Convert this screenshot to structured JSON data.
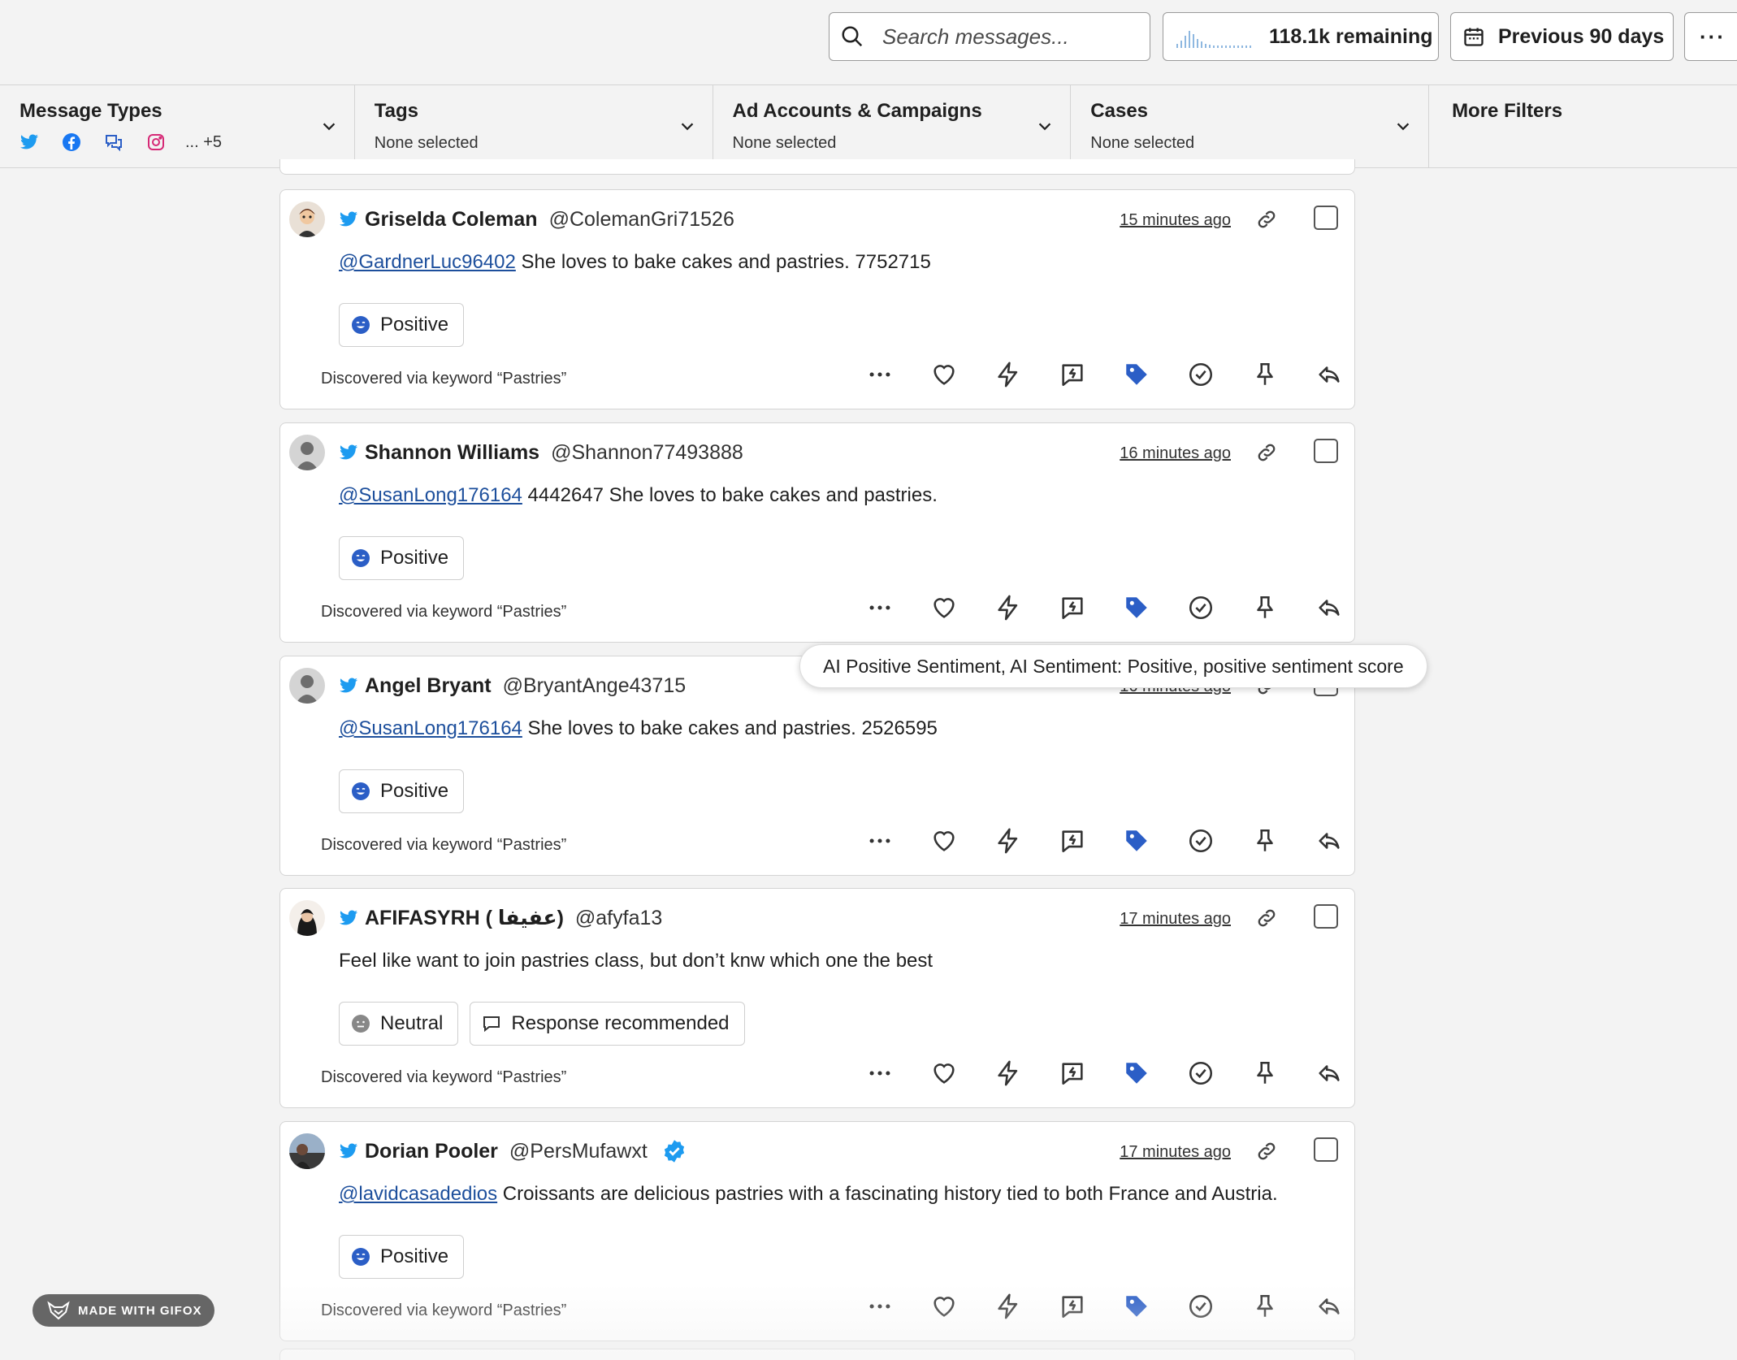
{
  "search": {
    "placeholder": "Search messages..."
  },
  "quota": {
    "label": "118.1k remaining"
  },
  "date_range": {
    "label": "Previous 90 days"
  },
  "more_menu": {
    "label": "···"
  },
  "filters": {
    "message_types": {
      "title": "Message Types",
      "extra": "... +5",
      "icons": [
        "twitter-icon",
        "facebook-icon",
        "chat-icon",
        "instagram-icon"
      ]
    },
    "tags": {
      "title": "Tags",
      "value": "None selected"
    },
    "ad_accounts": {
      "title": "Ad Accounts & Campaigns",
      "value": "None selected"
    },
    "cases": {
      "title": "Cases",
      "value": "None selected"
    },
    "more_filters": {
      "title": "More Filters"
    }
  },
  "messages": [
    {
      "name": "Griselda Coleman",
      "handle": "@ColemanGri71526",
      "time": "15 minutes ago",
      "mention": "@GardnerLuc96402",
      "text": " She loves to bake cakes and pastries. 7752715",
      "badges": [
        {
          "label": "Positive",
          "icon": "positive-icon"
        }
      ],
      "discovered": "Discovered via keyword “Pastries”",
      "avatar": "cartoon"
    },
    {
      "name": "Shannon Williams",
      "handle": "@Shannon77493888",
      "time": "16 minutes ago",
      "mention": "@SusanLong176164",
      "text": " 4442647 She loves to bake cakes and pastries.",
      "badges": [
        {
          "label": "Positive",
          "icon": "positive-icon"
        }
      ],
      "discovered": "Discovered via keyword “Pastries”",
      "avatar": "default"
    },
    {
      "name": "Angel Bryant",
      "handle": "@BryantAnge43715",
      "time": "16 minutes ago",
      "mention": "@SusanLong176164",
      "text": " She loves to bake cakes and pastries. 2526595",
      "badges": [
        {
          "label": "Positive",
          "icon": "positive-icon"
        }
      ],
      "discovered": "Discovered via keyword “Pastries”",
      "avatar": "default"
    },
    {
      "name": "AFIFASYRH ( عفيفا)",
      "handle": "@afyfa13",
      "time": "17 minutes ago",
      "mention": "",
      "text": "Feel like want to join pastries class, but don’t knw which one the best",
      "badges": [
        {
          "label": "Neutral",
          "icon": "neutral-icon"
        },
        {
          "label": "Response recommended",
          "icon": "comment-icon"
        }
      ],
      "discovered": "Discovered via keyword “Pastries”",
      "avatar": "photo-dark"
    },
    {
      "name": "Dorian Pooler",
      "handle": "@PersMufawxt",
      "time": "17 minutes ago",
      "mention": "@lavidcasadedios",
      "text": " Croissants are delicious pastries with a fascinating history tied to both France and Austria.",
      "badges": [
        {
          "label": "Positive",
          "icon": "positive-icon"
        }
      ],
      "discovered": "Discovered via keyword “Pastries”",
      "avatar": "photo-landscape",
      "verified": true
    }
  ],
  "tooltip": {
    "text": "AI Positive Sentiment, AI Sentiment: Positive, positive sentiment score"
  },
  "watermark": {
    "text": "MADE WITH GIFOX"
  },
  "colors": {
    "twitter": "#1d9bf0",
    "tag_blue": "#2b5ec6",
    "mention": "#1d4f9c"
  }
}
